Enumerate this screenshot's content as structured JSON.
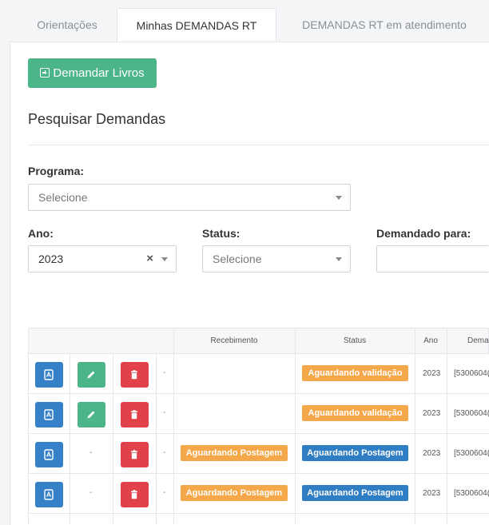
{
  "tabs": [
    {
      "label": "Orientações"
    },
    {
      "label": "Minhas DEMANDAS RT"
    },
    {
      "label": "DEMANDAS RT em atendimento"
    }
  ],
  "demandar_button": "Demandar Livros",
  "section_title": "Pesquisar Demandas",
  "filters": {
    "programa_label": "Programa:",
    "programa_value": "Selecione",
    "ano_label": "Ano:",
    "ano_value": "2023",
    "ano_clear": "×",
    "status_label": "Status:",
    "status_value": "Selecione",
    "demandado_label": "Demandado para:",
    "demandado_value": ""
  },
  "table": {
    "headers": [
      "Recebimento",
      "Status",
      "Ano",
      "Dema"
    ],
    "rows": [
      {
        "actions": [
          "pdf",
          "edit",
          "delete"
        ],
        "recebimento": "",
        "status": "Aguardando validação",
        "ano": "2023",
        "demanda": "[5300604("
      },
      {
        "actions": [
          "pdf",
          "edit",
          "delete"
        ],
        "recebimento": "",
        "status": "Aguardando validação",
        "ano": "2023",
        "demanda": "[5300604("
      },
      {
        "actions": [
          "pdf",
          "-",
          "delete"
        ],
        "recebimento": "Aguardando Postagem",
        "status": "Aguardando Postagem",
        "ano": "2023",
        "demanda": "[5300604("
      },
      {
        "actions": [
          "pdf",
          "-",
          "delete"
        ],
        "recebimento": "Aguardando Postagem",
        "status": "Aguardando Postagem",
        "ano": "2023",
        "demanda": "[5300604("
      }
    ],
    "dash": "-"
  },
  "colors": {
    "green": "#4cb58a",
    "blue": "#3680c7",
    "red": "#e0414a",
    "orange": "#f5a849"
  }
}
